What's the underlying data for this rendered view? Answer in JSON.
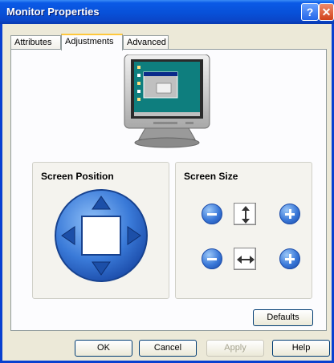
{
  "window": {
    "title": "Monitor Properties"
  },
  "titlebar": {
    "help_glyph": "?",
    "close_glyph": "✕"
  },
  "tabs": [
    {
      "label": "Attributes"
    },
    {
      "label": "Adjustments",
      "active": true
    },
    {
      "label": "Advanced"
    }
  ],
  "screen_position": {
    "label": "Screen Position"
  },
  "screen_size": {
    "label": "Screen Size"
  },
  "buttons": {
    "defaults": "Defaults",
    "ok": "OK",
    "cancel": "Cancel",
    "apply": "Apply",
    "help": "Help"
  },
  "colors": {
    "titlebar": "#0a5ae6",
    "dialog_bg": "#ece9d8",
    "control_blue": "#3a78d8"
  }
}
